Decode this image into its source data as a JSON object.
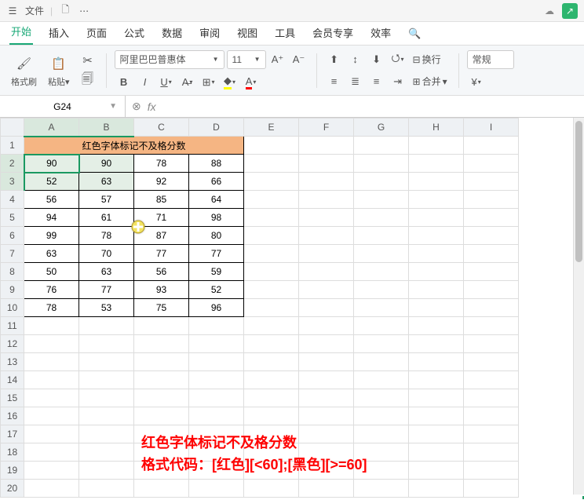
{
  "titlebar": {
    "file_label": "文件"
  },
  "tabs": {
    "items": [
      "开始",
      "插入",
      "页面",
      "公式",
      "数据",
      "审阅",
      "视图",
      "工具",
      "会员专享",
      "效率"
    ],
    "active_index": 0
  },
  "ribbon": {
    "fmt_brush": "格式刷",
    "paste": "粘贴",
    "font_name": "阿里巴巴普惠体",
    "font_size": "11",
    "wrap": "换行",
    "merge": "合并",
    "normal": "常规"
  },
  "namebox": "G24",
  "columns": [
    "A",
    "B",
    "C",
    "D",
    "E",
    "F",
    "G",
    "H",
    "I"
  ],
  "merged_title": "红色字体标记不及格分数",
  "data": [
    [
      90,
      90,
      78,
      88
    ],
    [
      52,
      63,
      92,
      66
    ],
    [
      56,
      57,
      85,
      64
    ],
    [
      94,
      61,
      71,
      98
    ],
    [
      99,
      78,
      87,
      80
    ],
    [
      63,
      70,
      77,
      77
    ],
    [
      50,
      63,
      56,
      59
    ],
    [
      76,
      77,
      93,
      52
    ],
    [
      78,
      53,
      75,
      96
    ]
  ],
  "row_count": 20,
  "annotation": {
    "line1": "红色字体标记不及格分数",
    "line2": "格式代码：[红色][<60];[黑色][>=60]"
  }
}
